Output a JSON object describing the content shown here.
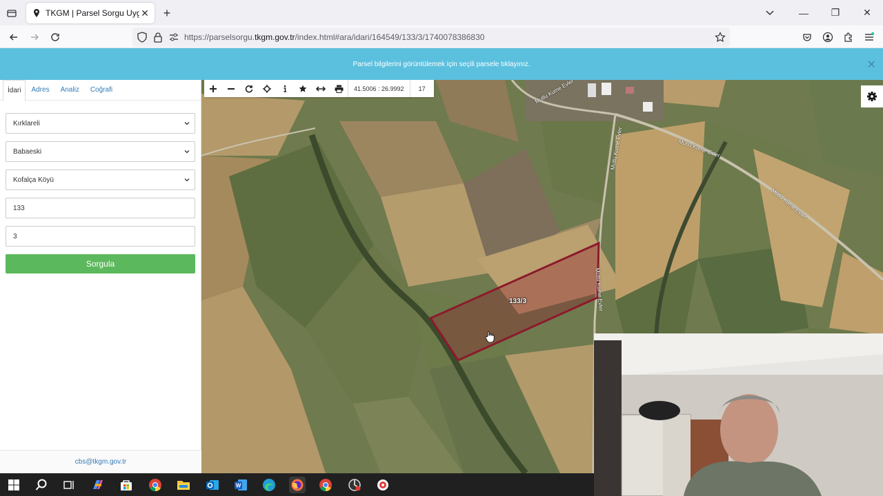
{
  "browser": {
    "tab_title": "TKGM | Parsel Sorgu Uygulama",
    "url_prefix": "https://parselsorgu.",
    "url_domain": "tkgm.gov.tr",
    "url_suffix": "/index.html#ara/idari/164549/133/3/1740078386830"
  },
  "banner": {
    "message": "Parsel bilgilerini görüntülemek için seçili parsele tıklayınız."
  },
  "sidebar": {
    "tabs": [
      {
        "label": "İdari"
      },
      {
        "label": "Adres"
      },
      {
        "label": "Analiz"
      },
      {
        "label": "Coğrafi"
      }
    ],
    "il": "Kırklareli",
    "ilce": "Babaeski",
    "mahalle": "Kofalça Köyü",
    "ada": "133",
    "parsel": "3",
    "submit_label": "Sorgula",
    "footer_email": "cbs@tkgm.gov.tr"
  },
  "map": {
    "coordinates": "41.5006 : 26.9992",
    "zoom_level": "17",
    "parcel_label": "133/3",
    "road_labels": [
      "Mutlu Kume Evler",
      "Mutlu Kume Evler",
      "Mutlu Kume Evler",
      "Mutlu Kume Evler",
      "Mutlu Kume Evler"
    ],
    "parcel_color": "#8b1a2b"
  }
}
